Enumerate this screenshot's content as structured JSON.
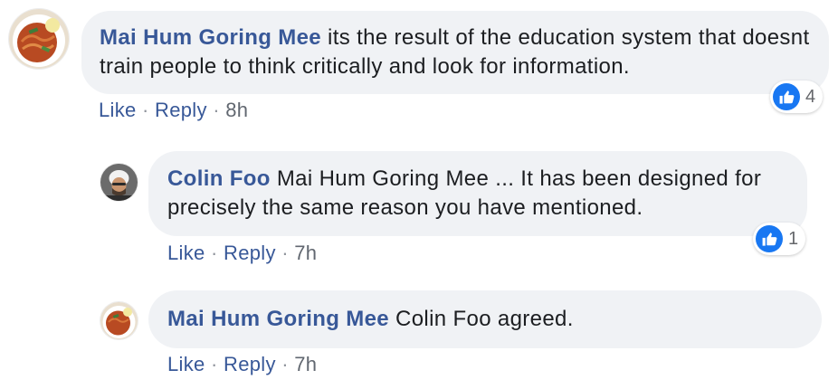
{
  "comments": [
    {
      "author": "Mai Hum Goring Mee",
      "text": "its the result of the education system that doesnt train people to think critically and look for information.",
      "actions": {
        "like": "Like",
        "reply": "Reply",
        "time": "8h"
      },
      "reaction_icon": "like-thumb-icon",
      "reaction_count": "4",
      "avatar_icon": "food-plate-icon"
    },
    {
      "author": "Colin Foo",
      "text": "Mai Hum Goring Mee ... It has been designed for precisely the same reason you have mentioned.",
      "actions": {
        "like": "Like",
        "reply": "Reply",
        "time": "7h"
      },
      "reaction_icon": "like-thumb-icon",
      "reaction_count": "1",
      "avatar_icon": "person-photo-icon"
    },
    {
      "author": "Mai Hum Goring Mee",
      "text": "Colin Foo agreed.",
      "actions": {
        "like": "Like",
        "reply": "Reply",
        "time": "7h"
      },
      "avatar_icon": "food-plate-icon"
    }
  ],
  "separator": "·",
  "colors": {
    "author": "#385898",
    "bubble": "#f0f2f5",
    "like_badge": "#1877f2",
    "meta": "#616770"
  }
}
